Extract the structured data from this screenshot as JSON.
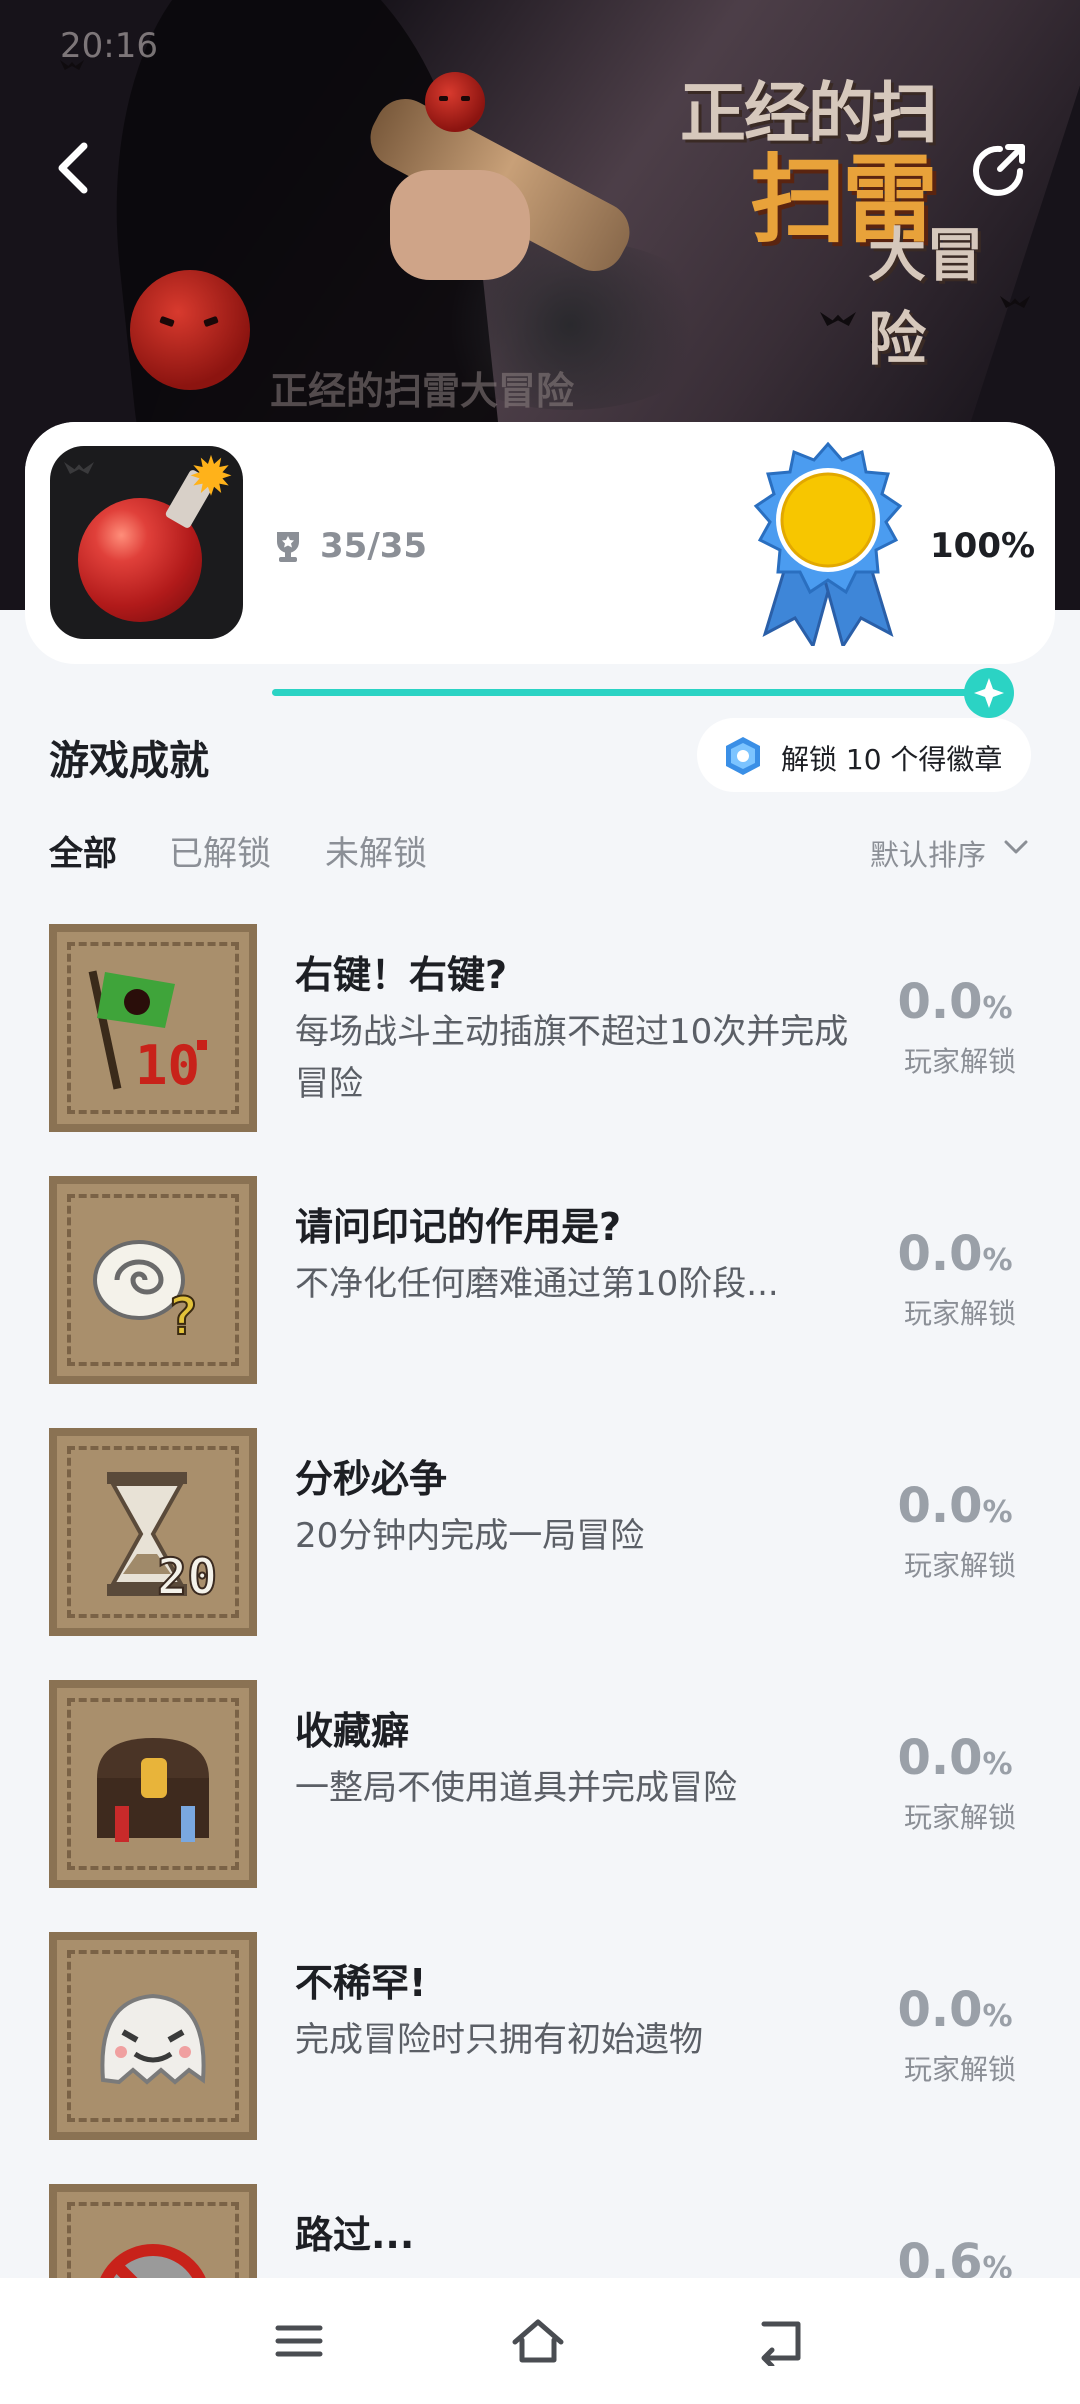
{
  "status_bar": {
    "time": "20:16"
  },
  "hero": {
    "logo_line1": "正经的扫",
    "logo_line2": "扫雷",
    "logo_line3": "大冒险",
    "subtitle": "正经的扫雷大冒险"
  },
  "summary": {
    "trophy_count": "35/35",
    "percent": "100%",
    "progress_fraction": 1.0
  },
  "section": {
    "title": "游戏成就",
    "badge_text": "解锁 10 个得徽章"
  },
  "tabs": [
    {
      "label": "全部",
      "active": true
    },
    {
      "label": "已解锁",
      "active": false
    },
    {
      "label": "未解锁",
      "active": false
    }
  ],
  "sort": {
    "label": "默认排序"
  },
  "achievements": [
    {
      "title": "右键！右键?",
      "desc": "每场战斗主动插旗不超过10次并完成冒险",
      "pct": "0.0",
      "pct_unit": "%",
      "pct_label": "玩家解锁",
      "icon": "flag-icon"
    },
    {
      "title": "请问印记的作用是?",
      "desc": "不净化任何磨难通过第10阶段...",
      "pct": "0.0",
      "pct_unit": "%",
      "pct_label": "玩家解锁",
      "icon": "swirl-question-icon"
    },
    {
      "title": "分秒必争",
      "desc": "20分钟内完成一局冒险",
      "pct": "0.0",
      "pct_unit": "%",
      "pct_label": "玩家解锁",
      "icon": "hourglass-icon"
    },
    {
      "title": "收藏癖",
      "desc": "一整局不使用道具并完成冒险",
      "pct": "0.0",
      "pct_unit": "%",
      "pct_label": "玩家解锁",
      "icon": "chest-icon"
    },
    {
      "title": "不稀罕!",
      "desc": "完成冒险时只拥有初始遗物",
      "pct": "0.0",
      "pct_unit": "%",
      "pct_label": "玩家解锁",
      "icon": "ghost-icon"
    },
    {
      "title": "路过...",
      "desc": "",
      "pct": "0.6",
      "pct_unit": "%",
      "pct_label": "",
      "icon": "prohibited-icon"
    }
  ],
  "colors": {
    "accent": "#2bd3c4",
    "gold": "#f7c600",
    "ribbon": "#4a8fe0"
  }
}
